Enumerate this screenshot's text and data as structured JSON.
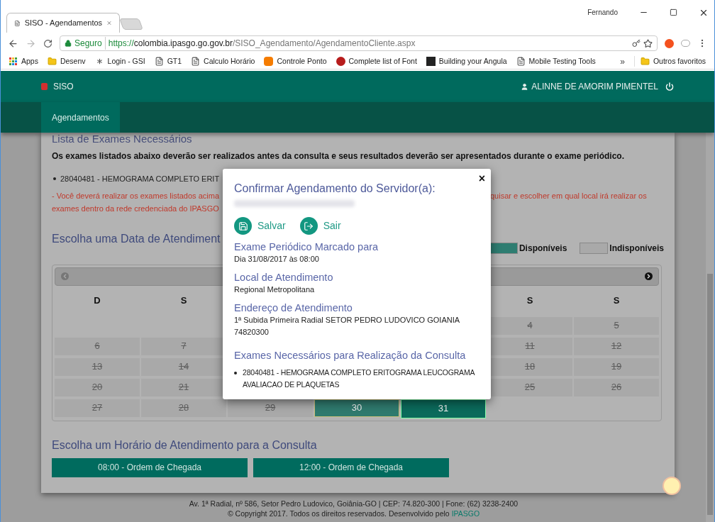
{
  "browser": {
    "tabs": [
      {
        "title": "SISO - Agendamentos",
        "selected": true
      }
    ],
    "profile": "Fernando",
    "url": {
      "secure_label": "Seguro",
      "scheme": "https://",
      "host": "colombia.ipasgo.go.gov.br",
      "path": "/SISO_Agendamento/AgendamentoCliente.aspx"
    },
    "bookmarks": [
      {
        "label": "Apps",
        "kind": "apps"
      },
      {
        "label": "Desenv",
        "kind": "folder"
      },
      {
        "label": "Login - GSI",
        "kind": "star"
      },
      {
        "label": "GT1",
        "kind": "page"
      },
      {
        "label": "Calculo Horário",
        "kind": "page"
      },
      {
        "label": "Controle Ponto",
        "kind": "orange"
      },
      {
        "label": "Complete list of Font",
        "kind": "dot"
      },
      {
        "label": "Building your Angula",
        "kind": "dark"
      },
      {
        "label": "Mobile Testing Tools",
        "kind": "page"
      }
    ],
    "overflow": "»",
    "other_bookmarks": "Outros favoritos"
  },
  "app": {
    "brand": "SISO",
    "user": "ALINNE DE AMORIM PIMENTEL",
    "nav": [
      {
        "label": "Agendamentos",
        "selected": true
      }
    ]
  },
  "page": {
    "exams_title": "Lista de Exames Necessários",
    "exams_intro": "Os exames listados abaixo deverão ser realizados antes da consulta e seus resultados deverão ser apresentados durante o exame periódico.",
    "exam_items": [
      "28040481 - HEMOGRAMA COMPLETO ERIT"
    ],
    "note_left": [
      "- Você deverá realizar os exames listados acima",
      "exames dentro da rede credenciada do IPASGO"
    ],
    "note_right": [
      "quisar e escolher em qual local irá realizar os"
    ],
    "date_heading": "Escolha uma Data de Atendiment",
    "legend": [
      {
        "label": "Disponíveis",
        "color": "#2e7d71"
      },
      {
        "label": "Indisponíveis",
        "color": "#a9a9a9"
      }
    ],
    "calendar": {
      "weekdays": {
        "left": [
          "D",
          "S"
        ],
        "right": [
          "S",
          "S"
        ]
      },
      "weeks": [
        {
          "left": [
            {
              "kind": "blank"
            },
            {
              "kind": "blank"
            }
          ],
          "right": [
            {
              "day": "4",
              "kind": "unavailable"
            },
            {
              "day": "5",
              "kind": "unavailable"
            }
          ]
        },
        {
          "left": [
            {
              "day": "6",
              "kind": "unavailable"
            },
            {
              "day": "7",
              "kind": "unavailable"
            }
          ],
          "right": [
            {
              "day": "11",
              "kind": "unavailable"
            },
            {
              "day": "12",
              "kind": "unavailable"
            }
          ]
        },
        {
          "left": [
            {
              "day": "13",
              "kind": "unavailable"
            },
            {
              "day": "14",
              "kind": "unavailable"
            }
          ],
          "right": [
            {
              "day": "18",
              "kind": "unavailable"
            },
            {
              "day": "19",
              "kind": "unavailable"
            }
          ]
        },
        {
          "left": [
            {
              "day": "20",
              "kind": "unavailable"
            },
            {
              "day": "21",
              "kind": "unavailable"
            }
          ],
          "right": [
            {
              "day": "25",
              "kind": "unavailable"
            },
            {
              "day": "26",
              "kind": "unavailable"
            }
          ]
        },
        {
          "left": [
            {
              "day": "27",
              "kind": "unavailable"
            },
            {
              "day": "28",
              "kind": "unavailable"
            }
          ],
          "middle": [
            {
              "day": "29",
              "kind": "unavailable"
            },
            {
              "day": "30",
              "kind": "available"
            },
            {
              "day": "31",
              "kind": "selected"
            }
          ],
          "right": [
            {
              "kind": "blank"
            },
            {
              "kind": "blank"
            }
          ]
        }
      ]
    },
    "time_heading": "Escolha um Horário de Atendimento para a Consulta",
    "time_slots": [
      {
        "label": "08:00 - Ordem de Chegada"
      },
      {
        "label": "12:00 - Ordem de Chegada"
      }
    ],
    "footer": {
      "address": "Av. 1ª Radial, nº 586, Setor Pedro Ludovico, Goiânia-GO | CEP: 74.820-300 | Fone: (62) 3238-2400",
      "copyright": "© Copyright 2017. Todos os direitos reservados. Desenvolvido pelo",
      "link": "IPASGO"
    }
  },
  "modal": {
    "title": "Confirmar Agendamento do Servidor(a):",
    "close": "×",
    "actions": [
      {
        "label": "Salvar",
        "kind": "save"
      },
      {
        "label": "Sair",
        "kind": "exit"
      }
    ],
    "sections": [
      {
        "heading": "Exame Periódico Marcado para",
        "lines": [
          "Dia 31/08/2017 às 08:00"
        ]
      },
      {
        "heading": "Local de Atendimento",
        "lines": [
          "Regional Metropolitana"
        ]
      },
      {
        "heading": "Endereço de Atendimento",
        "lines": [
          "1ª Subida Primeira Radial SETOR PEDRO LUDOVICO GOIANIA",
          "74820300"
        ]
      }
    ],
    "exams_heading": "Exames Necessários para Realização da Consulta",
    "exams": [
      "28040481 - HEMOGRAMA COMPLETO ERITOGRAMA LEUCOGRAMA AVALIACAO DE PLAQUETAS"
    ]
  }
}
